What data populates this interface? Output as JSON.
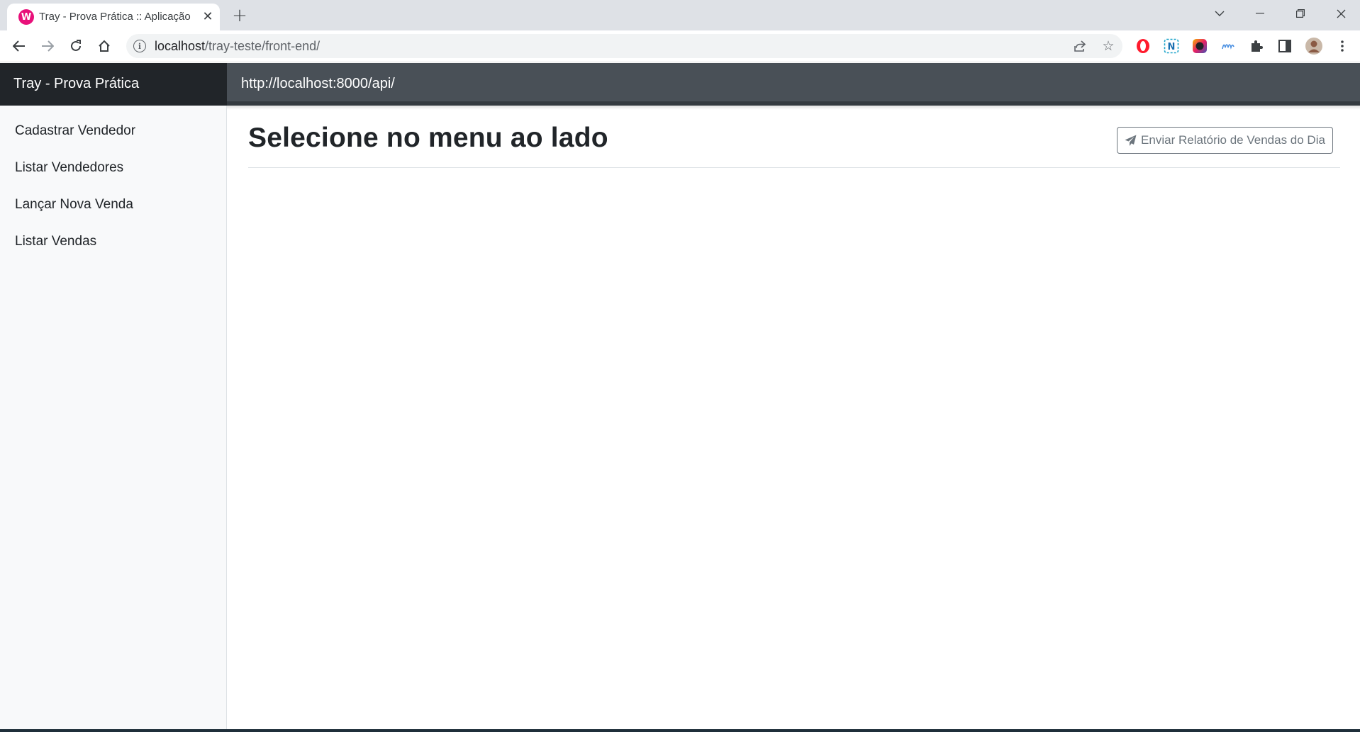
{
  "browser": {
    "tab_title": "Tray - Prova Prática :: Aplicação",
    "url_host": "localhost",
    "url_path": "/tray-teste/front-end/",
    "icons": {
      "favicon": "app-favicon",
      "close": "close-icon",
      "new_tab": "plus-icon",
      "back": "back-arrow-icon",
      "forward": "forward-arrow-icon",
      "reload": "reload-icon",
      "home": "home-icon",
      "info": "info-icon",
      "share": "share-icon",
      "bookmark": "star-icon",
      "extensions": "puzzle-icon",
      "side_panel": "side-panel-icon",
      "menu": "kebab-menu-icon"
    }
  },
  "app": {
    "brand": "Tray - Prova Prática",
    "api_url": "http://localhost:8000/api/",
    "colors": {
      "brand_bg": "#212529",
      "header_bg": "#495057",
      "sidebar_bg": "#f8f9fa",
      "button_border": "#6c757d"
    }
  },
  "sidebar": {
    "items": [
      {
        "label": "Cadastrar Vendedor"
      },
      {
        "label": "Listar Vendedores"
      },
      {
        "label": "Lançar Nova Venda"
      },
      {
        "label": "Listar Vendas"
      }
    ]
  },
  "main": {
    "title": "Selecione no menu ao lado",
    "report_button_label": "Enviar Relatório de Vendas do Dia",
    "report_button_icon": "paper-plane-icon"
  }
}
